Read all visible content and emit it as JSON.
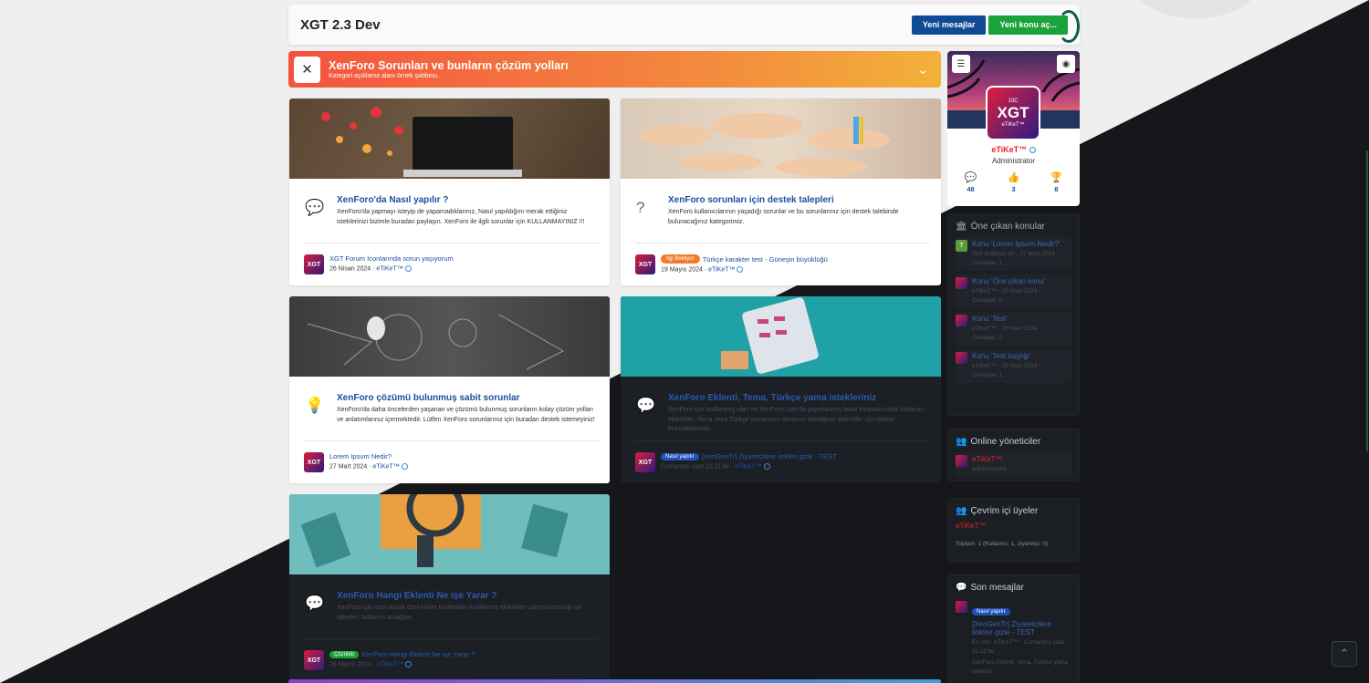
{
  "header": {
    "title": "XGT 2.3 Dev",
    "new_messages": "Yeni mesajlar",
    "new_thread": "Yeni konu aç..."
  },
  "category": {
    "title": "XenForo Sorunları ve bunların çözüm yolları",
    "description": "Kategori açıklama alanı örnek şablonu."
  },
  "forums": [
    {
      "title": "XenForo'da Nasıl yapılır ?",
      "description": "XenForo'da yapmayı isteyip de yapamadıklarınız, Nasıl yapıldığını merak ettiğiniz isteklerinizi bizimle buradan paylaşın. XenForo ile ilgili sorunlar için KULLANMAYINIZ !!!",
      "last_prefix": "",
      "last_title": "XGT Forum İconlarında sorun yaşıyorum",
      "last_date": "26 Nisan 2024",
      "last_user": "eTiKeT™",
      "icon": "comments-icon"
    },
    {
      "title": "XenForo sorunları için destek talepleri",
      "description": "XenForo kullanıcılarının yaşadığı sorunlar ve bu sorunlarınız için destek talebinde bulunacağınız kategorimiz.",
      "last_prefix": "İlgi Bekliyor",
      "last_title": "Türkçe karakter test - Güneşin büyüklüğü",
      "last_date": "19 Mayıs 2024",
      "last_user": "eTiKeT™",
      "icon": "question-icon"
    },
    {
      "title": "XenForo çözümü bulunmuş sabit sorunlar",
      "description": "XenForo'da daha öncelerden yaşanan ve çözümü bulunmuş sorunların kolay çözüm yolları ve anlatımlarınız içermektedir. Lütfen XenForo sorunlarınız için buradan destek istemeyiniz!",
      "last_prefix": "",
      "last_title": "Lorem Ipsum Nedir?",
      "last_date": "27 Mart 2024",
      "last_user": "eTiKeT™",
      "icon": "lightbulb-icon"
    },
    {
      "title": "XenForo Eklenti, Tema, Türkçe yama istekleriniz",
      "description": "XenForo için kodlanmış olan ve XenForo.com'da yayınlanmış fakat forumumuzda olmayan eklentiler, Tema veya Türkçe yamasının olmasını istediğiniz eklentiler için istekte bulunabilirsiniz.",
      "last_prefix": "Nasıl yapılır",
      "last_title": "[XenGenTr] Ziyaretçilere linkleri gizle - TEST",
      "last_date": "Cumartesi saat 22:11'de",
      "last_user": "eTiKeT™",
      "icon": "comments-icon"
    },
    {
      "title": "XenForo Hangi Eklenti Ne işe Yarar ?",
      "description": "XenForo için özel olarak özel kişiler tarafından kodlanmış eklentiler çalışma mantığı ve işlevleri, kullanım amaçları.",
      "last_prefix": "Çözüldü",
      "last_title": "XenForo Hangi Eklenti Ne işe Yarar ?",
      "last_date": "26 Mayıs 2024",
      "last_user": "eTiKeT™",
      "icon": "comments-icon"
    }
  ],
  "profile": {
    "name": "eTiKeT™",
    "role": "Administrator",
    "logo_text": "XGT",
    "logo_sub": "eTiKeT™",
    "logo_top": "10C",
    "stats": [
      "48",
      "3",
      "8"
    ]
  },
  "featured": {
    "heading": "Öne çıkan konular",
    "items": [
      {
        "title": "Konu 'Lorem Ipsum Nedir?'",
        "meta": "Test kullanıcı 10 · 27 Mart 2024 ·",
        "replies": "Cevaplar: 1",
        "avatar": "T"
      },
      {
        "title": "Konu 'Öne çıkan konu'",
        "meta": "eTiKeT™ · 20 Mart 2024 ·",
        "replies": "Cevaplar: 0",
        "avatar": ""
      },
      {
        "title": "Konu 'Test'",
        "meta": "eTiKeT™ · 19 Mart 2024 ·",
        "replies": "Cevaplar: 0",
        "avatar": ""
      },
      {
        "title": "Konu 'Test başlığı'",
        "meta": "eTiKeT™ · 20 Mart 2024 ·",
        "replies": "Cevaplar: 1",
        "avatar": ""
      }
    ]
  },
  "online_staff": {
    "heading": "Online yöneticiler",
    "name": "eTiKeT™",
    "role": "Administrator"
  },
  "online_members": {
    "heading": "Çevrim içi üyeler",
    "name": "eTiKeT™",
    "total": "Toplam: 1 (Kullanıcı: 1, ziyaretçi: 0)"
  },
  "recent_posts": {
    "heading": "Son mesajlar",
    "prefix": "Nasıl yapılır",
    "title": "[XenGenTr] Ziyaretçilere linkleri gizle - TEST",
    "meta": "En son: eTiKeT™ · Cumartesi saat 22:11'de",
    "forum": "XenForo Eklenti, tema, Türkçe yama istekleri"
  }
}
